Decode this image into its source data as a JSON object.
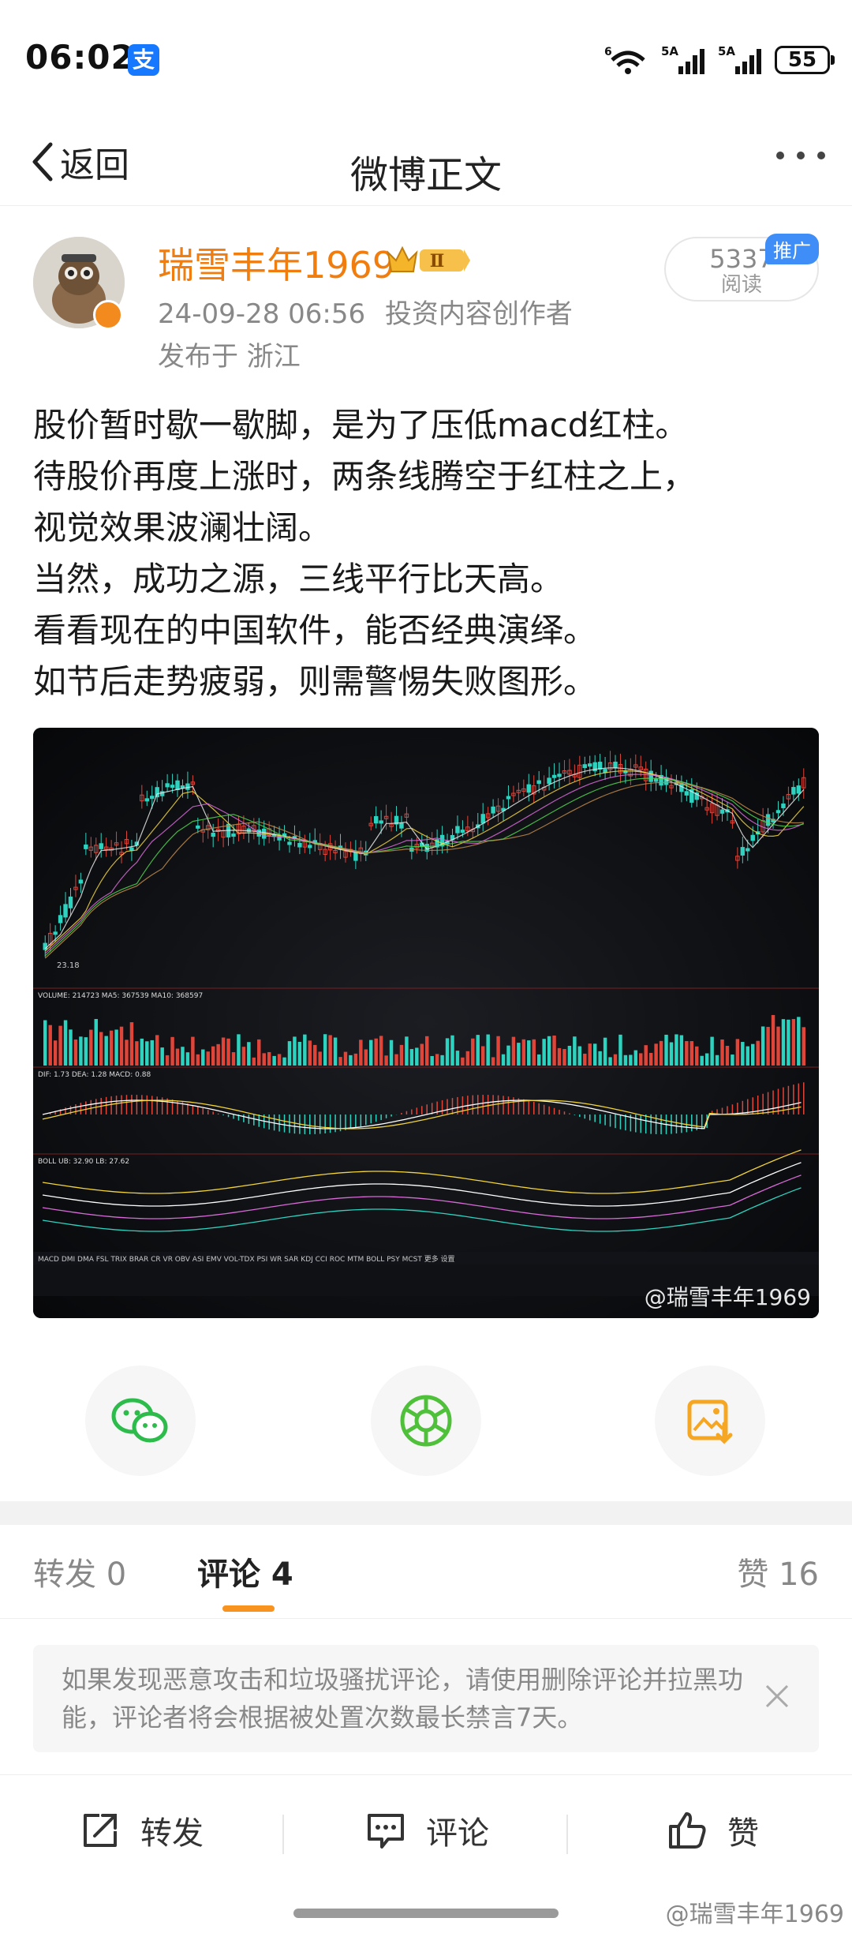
{
  "status_bar": {
    "time": "06:02",
    "alipay_glyph": "支",
    "signal1_label": "5A",
    "signal2_label": "5A",
    "wifi_label": "6",
    "battery": "55"
  },
  "nav": {
    "back_label": "返回",
    "title": "微博正文"
  },
  "post": {
    "username": "瑞雪丰年1969",
    "vip_level": "Ⅱ",
    "datetime": "24-09-28 06:56",
    "author_tag": "投资内容创作者",
    "location": "发布于 浙江",
    "reads_count": "5337",
    "reads_label": "阅读",
    "promo_badge": "推广",
    "lines": [
      "股价暂时歇一歇脚，是为了压低macd红柱。",
      "待股价再度上涨时，两条线腾空于红柱之上，",
      "视觉效果波澜壮阔。",
      "当然，成功之源，三线平行比天高。",
      "看看现在的中国软件，能否经典演绎。",
      "如节后走势疲弱，则需警惕失败图形。"
    ],
    "image_watermark": "@瑞雪丰年1969"
  },
  "image_chart": {
    "low_label": "23.18",
    "volume_label": "VOLUME: 214723  MA5: 367539  MA10: 368597",
    "macd_label": "DIF: 1.73  DEA: 1.28  MACD: 0.88",
    "boll_label": "BOLL  UB: 32.90  LB: 27.62",
    "indicator_tabs": "MACD  DMI  DMA  FSL  TRIX  BRAR  CR  VR  OBV  ASI  EMV  VOL-TDX  PSI  WR  SAR  KDJ  CCI  ROC  MTM  BOLL  PSY  MCST  更多  设置"
  },
  "tabs": {
    "repost": "转发 0",
    "comments": "评论 4",
    "likes": "赞 16"
  },
  "notice": {
    "text": "如果发现恶意攻击和垃圾骚扰评论，请使用删除评论并拉黑功能，评论者将会根据被处置次数最长禁言7天。"
  },
  "bottom_bar": {
    "repost": "转发",
    "comment": "评论",
    "like": "赞"
  },
  "page_watermark": "@瑞雪丰年1969",
  "colors": {
    "username": "#f07d0e",
    "accent_tab": "#f7931e",
    "wechat": "#2dbb4b",
    "moments": "#4fc03a",
    "save": "#f5a623",
    "promo": "#3f8ef7"
  }
}
